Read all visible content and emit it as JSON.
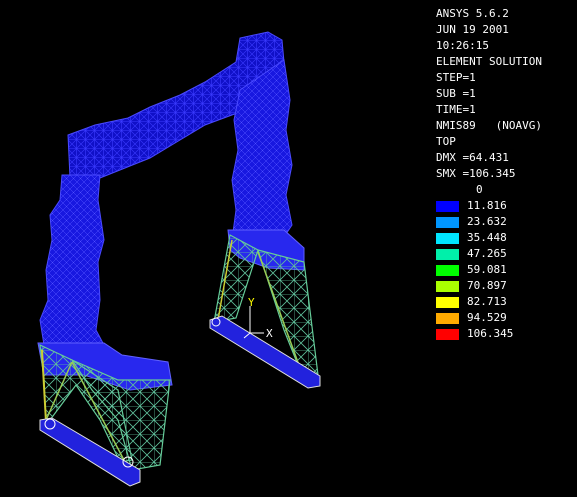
{
  "header": {
    "lines": [
      "ANSYS 5.6.2",
      "JUN 19 2001",
      "10:26:15",
      "ELEMENT SOLUTION",
      "STEP=1",
      "SUB =1",
      "TIME=1",
      "NMIS89   (NOAVG)",
      "TOP",
      "DMX =64.431",
      "SMX =106.345"
    ]
  },
  "legend": {
    "top_value": "0",
    "bands": [
      {
        "label": "11.816",
        "color": "#0000ff"
      },
      {
        "label": "23.632",
        "color": "#0096ff"
      },
      {
        "label": "35.448",
        "color": "#00e6ff"
      },
      {
        "label": "47.265",
        "color": "#00f0aa"
      },
      {
        "label": "59.081",
        "color": "#00ff00"
      },
      {
        "label": "70.897",
        "color": "#aaff00"
      },
      {
        "label": "82.713",
        "color": "#ffff00"
      },
      {
        "label": "94.529",
        "color": "#ffaa00"
      },
      {
        "label": "106.345",
        "color": "#ff0000"
      }
    ]
  },
  "triad": {
    "y_label": "Y",
    "x_label": "X"
  },
  "colors": {
    "background": "#000000",
    "mesh_blue": "#1a1aff",
    "mesh_dense": "#3030ff",
    "truss_green": "#66cc99",
    "truss_yellow": "#cccc33"
  }
}
